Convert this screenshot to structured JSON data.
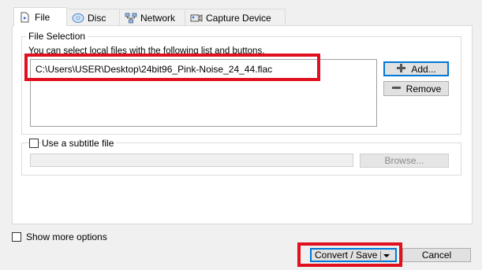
{
  "tabs": [
    {
      "label": "File",
      "icon": "file-icon",
      "active": true
    },
    {
      "label": "Disc",
      "icon": "disc-icon",
      "active": false
    },
    {
      "label": "Network",
      "icon": "network-icon",
      "active": false
    },
    {
      "label": "Capture Device",
      "icon": "capture-device-icon",
      "active": false
    }
  ],
  "file_selection": {
    "title": "File Selection",
    "hint": "You can select local files with the following list and buttons.",
    "files": [
      "C:\\Users\\USER\\Desktop\\24bit96_Pink-Noise_24_44.flac"
    ],
    "add_label": "Add...",
    "remove_label": "Remove"
  },
  "subtitle": {
    "checkbox_label": "Use a subtitle file",
    "checked": false,
    "path_value": "",
    "browse_label": "Browse..."
  },
  "footer": {
    "show_more_label": "Show more options",
    "show_more_checked": false,
    "convert_label": "Convert / Save",
    "cancel_label": "Cancel"
  },
  "colors": {
    "highlight": "#e0101e",
    "accent": "#0078d7",
    "plus_icon": "#3a7a3a",
    "disc_icon": "#6aa0d8"
  }
}
